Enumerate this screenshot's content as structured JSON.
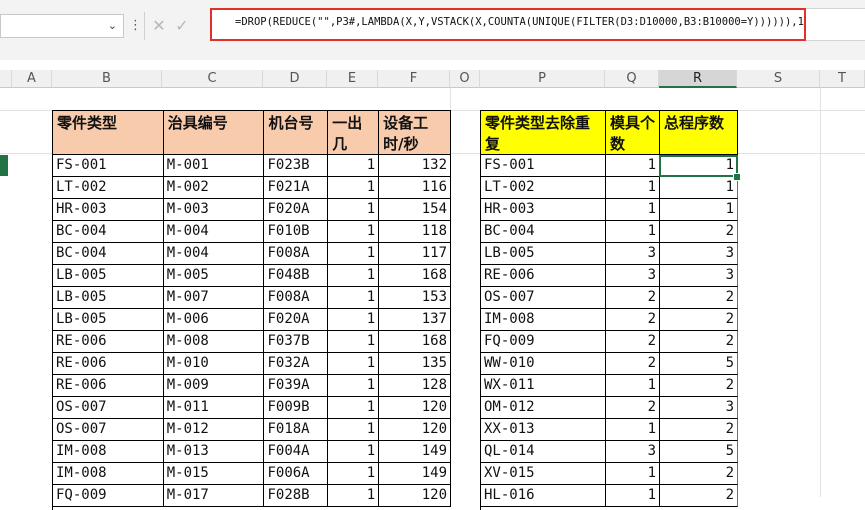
{
  "formula_bar": {
    "formula": "=DROP(REDUCE(\"\",P3#,LAMBDA(X,Y,VSTACK(X,COUNTA(UNIQUE(FILTER(D3:D10000,B3:B10000=Y)))))),1)",
    "dropdown_icon": "chevron-down",
    "menu_icon": "vertical-ellipsis",
    "cancel_icon": "x",
    "enter_icon": "checkmark"
  },
  "columns": [
    "A",
    "B",
    "C",
    "D",
    "E",
    "F",
    "O",
    "P",
    "Q",
    "R",
    "S",
    "T"
  ],
  "left_table": {
    "headers": [
      "零件类型",
      "治具编号",
      "机台号",
      "一出几",
      "设备工时/秒"
    ],
    "rows": [
      [
        "FS-001",
        "M-001",
        "F023B",
        "1",
        "132"
      ],
      [
        "LT-002",
        "M-002",
        "F021A",
        "1",
        "116"
      ],
      [
        "HR-003",
        "M-003",
        "F020A",
        "1",
        "154"
      ],
      [
        "BC-004",
        "M-004",
        "F010B",
        "1",
        "118"
      ],
      [
        "BC-004",
        "M-004",
        "F008A",
        "1",
        "117"
      ],
      [
        "LB-005",
        "M-005",
        "F048B",
        "1",
        "168"
      ],
      [
        "LB-005",
        "M-007",
        "F008A",
        "1",
        "153"
      ],
      [
        "LB-005",
        "M-006",
        "F020A",
        "1",
        "137"
      ],
      [
        "RE-006",
        "M-008",
        "F037B",
        "1",
        "168"
      ],
      [
        "RE-006",
        "M-010",
        "F032A",
        "1",
        "135"
      ],
      [
        "RE-006",
        "M-009",
        "F039A",
        "1",
        "128"
      ],
      [
        "OS-007",
        "M-011",
        "F009B",
        "1",
        "120"
      ],
      [
        "OS-007",
        "M-012",
        "F018A",
        "1",
        "120"
      ],
      [
        "IM-008",
        "M-013",
        "F004A",
        "1",
        "149"
      ],
      [
        "IM-008",
        "M-015",
        "F006A",
        "1",
        "149"
      ],
      [
        "FQ-009",
        "M-017",
        "F028B",
        "1",
        "120"
      ]
    ]
  },
  "right_table": {
    "headers": [
      "零件类型去除重复",
      "模具个数",
      "总程序数"
    ],
    "rows": [
      [
        "FS-001",
        "1",
        "1"
      ],
      [
        "LT-002",
        "1",
        "1"
      ],
      [
        "HR-003",
        "1",
        "1"
      ],
      [
        "BC-004",
        "1",
        "2"
      ],
      [
        "LB-005",
        "3",
        "3"
      ],
      [
        "RE-006",
        "3",
        "3"
      ],
      [
        "OS-007",
        "2",
        "2"
      ],
      [
        "IM-008",
        "2",
        "2"
      ],
      [
        "FQ-009",
        "2",
        "2"
      ],
      [
        "WW-010",
        "2",
        "5"
      ],
      [
        "WX-011",
        "1",
        "2"
      ],
      [
        "OM-012",
        "2",
        "3"
      ],
      [
        "XX-013",
        "1",
        "2"
      ],
      [
        "QL-014",
        "3",
        "5"
      ],
      [
        "XV-015",
        "1",
        "2"
      ],
      [
        "HL-016",
        "1",
        "2"
      ]
    ]
  },
  "colors": {
    "header_left": "#f8cbad",
    "header_right": "#ffff00",
    "formula_highlight": "#e0302a",
    "selection": "#217346"
  }
}
